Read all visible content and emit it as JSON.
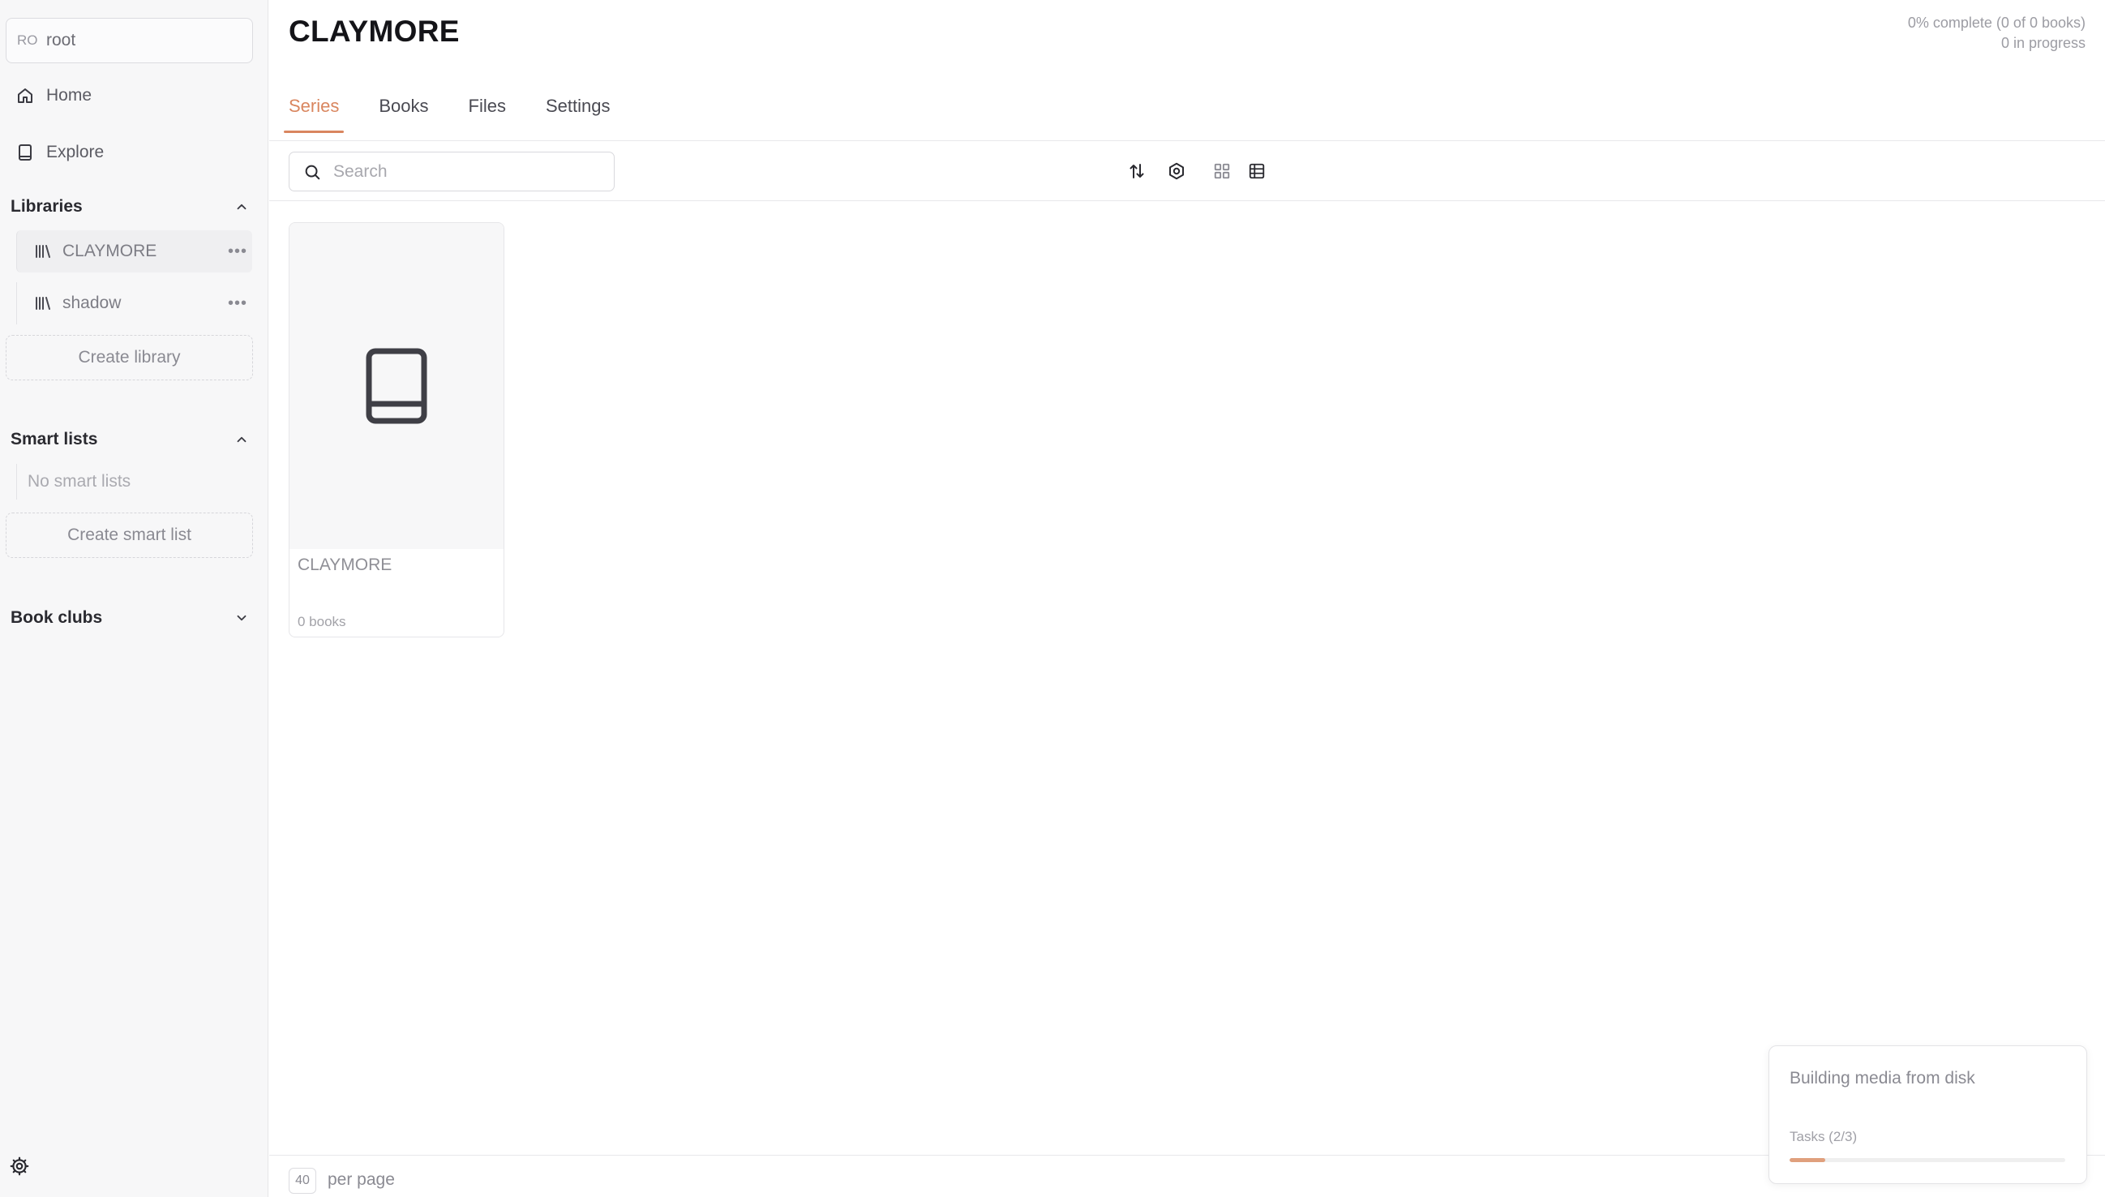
{
  "user": {
    "initials": "RO",
    "name": "root"
  },
  "nav": {
    "home": "Home",
    "explore": "Explore"
  },
  "libraries": {
    "title": "Libraries",
    "items": [
      {
        "label": "CLAYMORE",
        "active": true
      },
      {
        "label": "shadow",
        "active": false
      }
    ],
    "more_label": "•••",
    "create_label": "Create library"
  },
  "smart_lists": {
    "title": "Smart lists",
    "empty_label": "No smart lists",
    "create_label": "Create smart list"
  },
  "book_clubs": {
    "title": "Book clubs"
  },
  "page": {
    "title": "CLAYMORE",
    "progress_line1": "0% complete (0 of 0 books)",
    "progress_line2": "0 in progress"
  },
  "tabs": [
    "Series",
    "Books",
    "Files",
    "Settings"
  ],
  "active_tab": "Series",
  "search": {
    "placeholder": "Search",
    "value": ""
  },
  "series": [
    {
      "title": "CLAYMORE",
      "count_label": "0 books"
    }
  ],
  "footer": {
    "per_page": "40",
    "per_page_label": "per page"
  },
  "toast": {
    "title": "Building media from disk",
    "tasks_label": "Tasks (2/3)",
    "progress_fraction": 0.13
  },
  "colors": {
    "accent": "#d9865f",
    "progress": "#e0a07d"
  },
  "icons": [
    "home-icon",
    "book-icon",
    "library-icon",
    "chevron-up-icon",
    "chevron-down-icon",
    "search-icon",
    "sort-icon",
    "settings-icon",
    "grid-view-icon",
    "table-view-icon",
    "gear-icon"
  ]
}
